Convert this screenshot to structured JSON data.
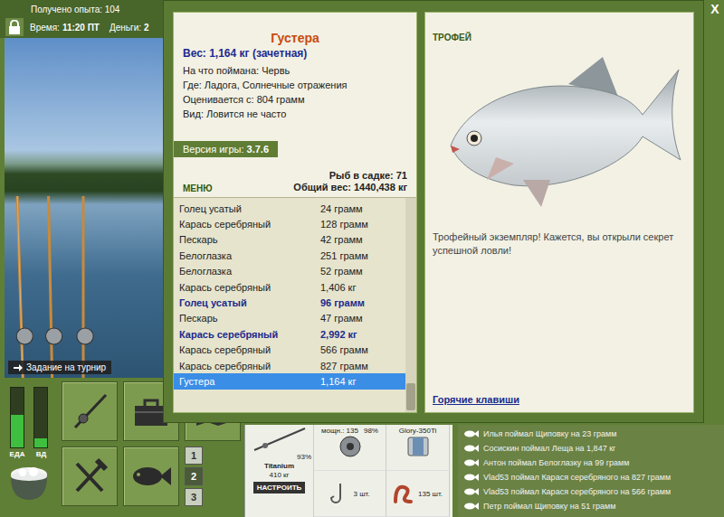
{
  "hud": {
    "experience": "Получено опыта: 104",
    "time_label": "Время:",
    "time": "11:20 ПТ",
    "money_label": "Деньги:",
    "money": "2"
  },
  "scene": {
    "task_button": "Задание на турнир"
  },
  "needs": [
    {
      "label": "ЕДА",
      "level": 0.55
    },
    {
      "label": "ВД",
      "level": 0.15
    }
  ],
  "rod_slots": [
    {
      "label": "1",
      "selected": false
    },
    {
      "label": "2",
      "selected": true
    },
    {
      "label": "3",
      "selected": false
    }
  ],
  "tackle": {
    "rod_wear": "93%",
    "rod_name": "Titanium",
    "rod_weight": "410 кг",
    "reel_power": "мощн.: 135",
    "reel_wear": "98%",
    "line_name": "Glory-350Ti",
    "hooks": "3 шт.",
    "bait": "135 шт.",
    "setup_button": "НАСТРОИТЬ"
  },
  "chat": [
    "Илья поймал Щиповку на 23 грамм",
    "Сосискин поймал Леща на 1,847 кг",
    "Антон поймал Белоглазку на 99 грамм",
    "Vlad53 поймал Карася серебряного на 827 грамм",
    "Vlad53 поймал Карася серебряного на 566 грамм",
    "Петр поймал Щиповку на 51 грамм"
  ],
  "dialog": {
    "close": "X",
    "fish": {
      "name": "Густера",
      "weight": "Вес: 1,164 кг (зачетная)",
      "details": [
        "На что поймана: Червь",
        "Где: Ладога, Солнечные отражения",
        "Оценивается с: 804 грамм",
        "Вид: Ловится не часто"
      ]
    },
    "version_label": "Версия игры:",
    "version": "3.7.6",
    "menu": "МЕНЮ",
    "keepnet_count": "Рыб в садке: 71",
    "keepnet_weight": "Общий вес: 1440,438 кг",
    "catches": [
      {
        "name": "Голец усатый",
        "weight": "24 грамм",
        "trophy": false,
        "selected": false
      },
      {
        "name": "Карась серебряный",
        "weight": "128 грамм",
        "trophy": false,
        "selected": false
      },
      {
        "name": "Пескарь",
        "weight": "42 грамм",
        "trophy": false,
        "selected": false
      },
      {
        "name": "Белоглазка",
        "weight": "251 грамм",
        "trophy": false,
        "selected": false
      },
      {
        "name": "Белоглазка",
        "weight": "52 грамм",
        "trophy": false,
        "selected": false
      },
      {
        "name": "Карась серебряный",
        "weight": "1,406 кг",
        "trophy": false,
        "selected": false
      },
      {
        "name": "Голец усатый",
        "weight": "96 грамм",
        "trophy": true,
        "selected": false
      },
      {
        "name": "Пескарь",
        "weight": "47 грамм",
        "trophy": false,
        "selected": false
      },
      {
        "name": "Карась серебряный",
        "weight": "2,992 кг",
        "trophy": true,
        "selected": false
      },
      {
        "name": "Карась серебряный",
        "weight": "566 грамм",
        "trophy": false,
        "selected": false
      },
      {
        "name": "Карась серебряный",
        "weight": "827 грамм",
        "trophy": false,
        "selected": false
      },
      {
        "name": "Густера",
        "weight": "1,164 кг",
        "trophy": false,
        "selected": true
      }
    ],
    "scroll_position": 1,
    "trophy_label": "ТРОФЕЙ",
    "trophy_message": "Трофейный экземпляр! Кажется, вы открыли секрет успешной ловли!",
    "hotkeys_link": "Горячие клавиши"
  }
}
